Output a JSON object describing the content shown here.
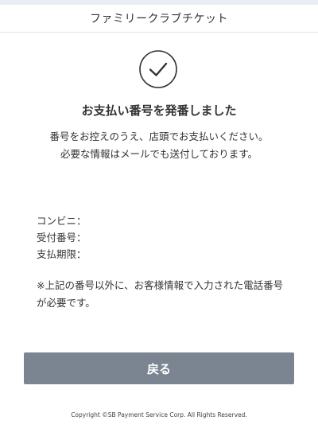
{
  "header": {
    "title": "ファミリークラブチケット"
  },
  "status": {
    "icon": "check-circle-icon",
    "heading": "お支払い番号を発番しました"
  },
  "message": {
    "line1": "番号をお控えのうえ、店頭でお支払いください。",
    "line2": "必要な情報はメールでも送付しております。"
  },
  "info": {
    "convenience_store_label": "コンビニ：",
    "reception_number_label": "受付番号：",
    "payment_deadline_label": "支払期限："
  },
  "note": {
    "text": "※上記の番号以外に、お客様情報で入力された電話番号が必要です。"
  },
  "actions": {
    "back_label": "戻る"
  },
  "footer": {
    "copyright": "Copyright ©SB Payment Service Corp. All Rights Reserved."
  },
  "colors": {
    "button_bg": "#7a8591",
    "text": "#333333",
    "top_bar": "#e9eef4"
  }
}
